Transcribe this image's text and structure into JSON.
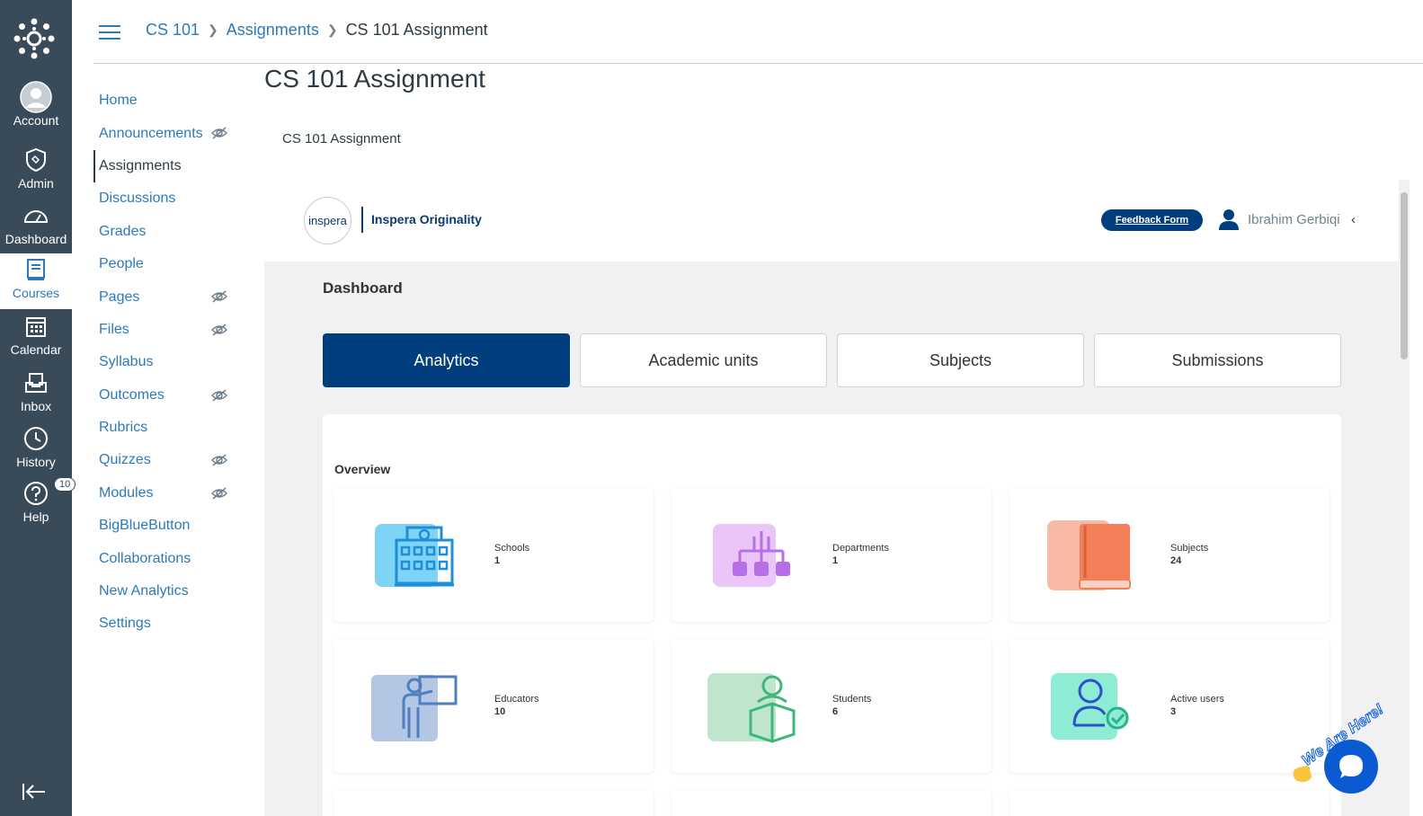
{
  "global_nav": {
    "items": [
      {
        "label": "Account",
        "icon": "account-icon"
      },
      {
        "label": "Admin",
        "icon": "shield-icon"
      },
      {
        "label": "Dashboard",
        "icon": "dashboard-icon"
      },
      {
        "label": "Courses",
        "icon": "book-icon"
      },
      {
        "label": "Calendar",
        "icon": "calendar-icon"
      },
      {
        "label": "Inbox",
        "icon": "inbox-icon"
      },
      {
        "label": "History",
        "icon": "clock-icon"
      },
      {
        "label": "Help",
        "icon": "help-icon",
        "badge": "10"
      }
    ],
    "active": "Courses"
  },
  "breadcrumb": {
    "course": "CS 101",
    "section": "Assignments",
    "current": "CS 101 Assignment"
  },
  "course_nav": {
    "items": [
      {
        "label": "Home",
        "hidden": false
      },
      {
        "label": "Announcements",
        "hidden": true
      },
      {
        "label": "Assignments",
        "hidden": false,
        "active": true
      },
      {
        "label": "Discussions",
        "hidden": false
      },
      {
        "label": "Grades",
        "hidden": false
      },
      {
        "label": "People",
        "hidden": false
      },
      {
        "label": "Pages",
        "hidden": true
      },
      {
        "label": "Files",
        "hidden": true
      },
      {
        "label": "Syllabus",
        "hidden": false
      },
      {
        "label": "Outcomes",
        "hidden": true
      },
      {
        "label": "Rubrics",
        "hidden": false
      },
      {
        "label": "Quizzes",
        "hidden": true
      },
      {
        "label": "Modules",
        "hidden": true
      },
      {
        "label": "BigBlueButton",
        "hidden": false
      },
      {
        "label": "Collaborations",
        "hidden": false
      },
      {
        "label": "New Analytics",
        "hidden": false
      },
      {
        "label": "Settings",
        "hidden": false
      }
    ]
  },
  "page": {
    "title": "CS 101 Assignment",
    "subtitle": "CS 101 Assignment"
  },
  "inspera": {
    "logo_text": "inspera",
    "product_name": "Inspera Originality",
    "feedback_label": "Feedback Form",
    "user_name": "Ibrahim Gerbiqi",
    "dashboard_title": "Dashboard",
    "tabs": [
      {
        "label": "Analytics",
        "active": true
      },
      {
        "label": "Academic units",
        "active": false
      },
      {
        "label": "Subjects",
        "active": false
      },
      {
        "label": "Submissions",
        "active": false
      }
    ],
    "overview_label": "Overview",
    "cards": [
      {
        "label": "Schools",
        "value": "1",
        "icon": "school-building-icon",
        "color": "#7fd3f5"
      },
      {
        "label": "Departments",
        "value": "1",
        "icon": "hierarchy-icon",
        "color": "#e9c6f7"
      },
      {
        "label": "Subjects",
        "value": "24",
        "icon": "book-icon",
        "color": "#f8b9a5"
      },
      {
        "label": "Educators",
        "value": "10",
        "icon": "teacher-icon",
        "color": "#b3c6e3"
      },
      {
        "label": "Students",
        "value": "6",
        "icon": "student-reading-icon",
        "color": "#bfe5cd"
      },
      {
        "label": "Active users",
        "value": "3",
        "icon": "active-user-icon",
        "color": "#8eecd5"
      }
    ]
  },
  "chat_widget": {
    "label": "We Are Here!"
  },
  "colors": {
    "nav_bg": "#394b58",
    "link": "#2b7abc",
    "inspera_blue": "#003e7e"
  }
}
